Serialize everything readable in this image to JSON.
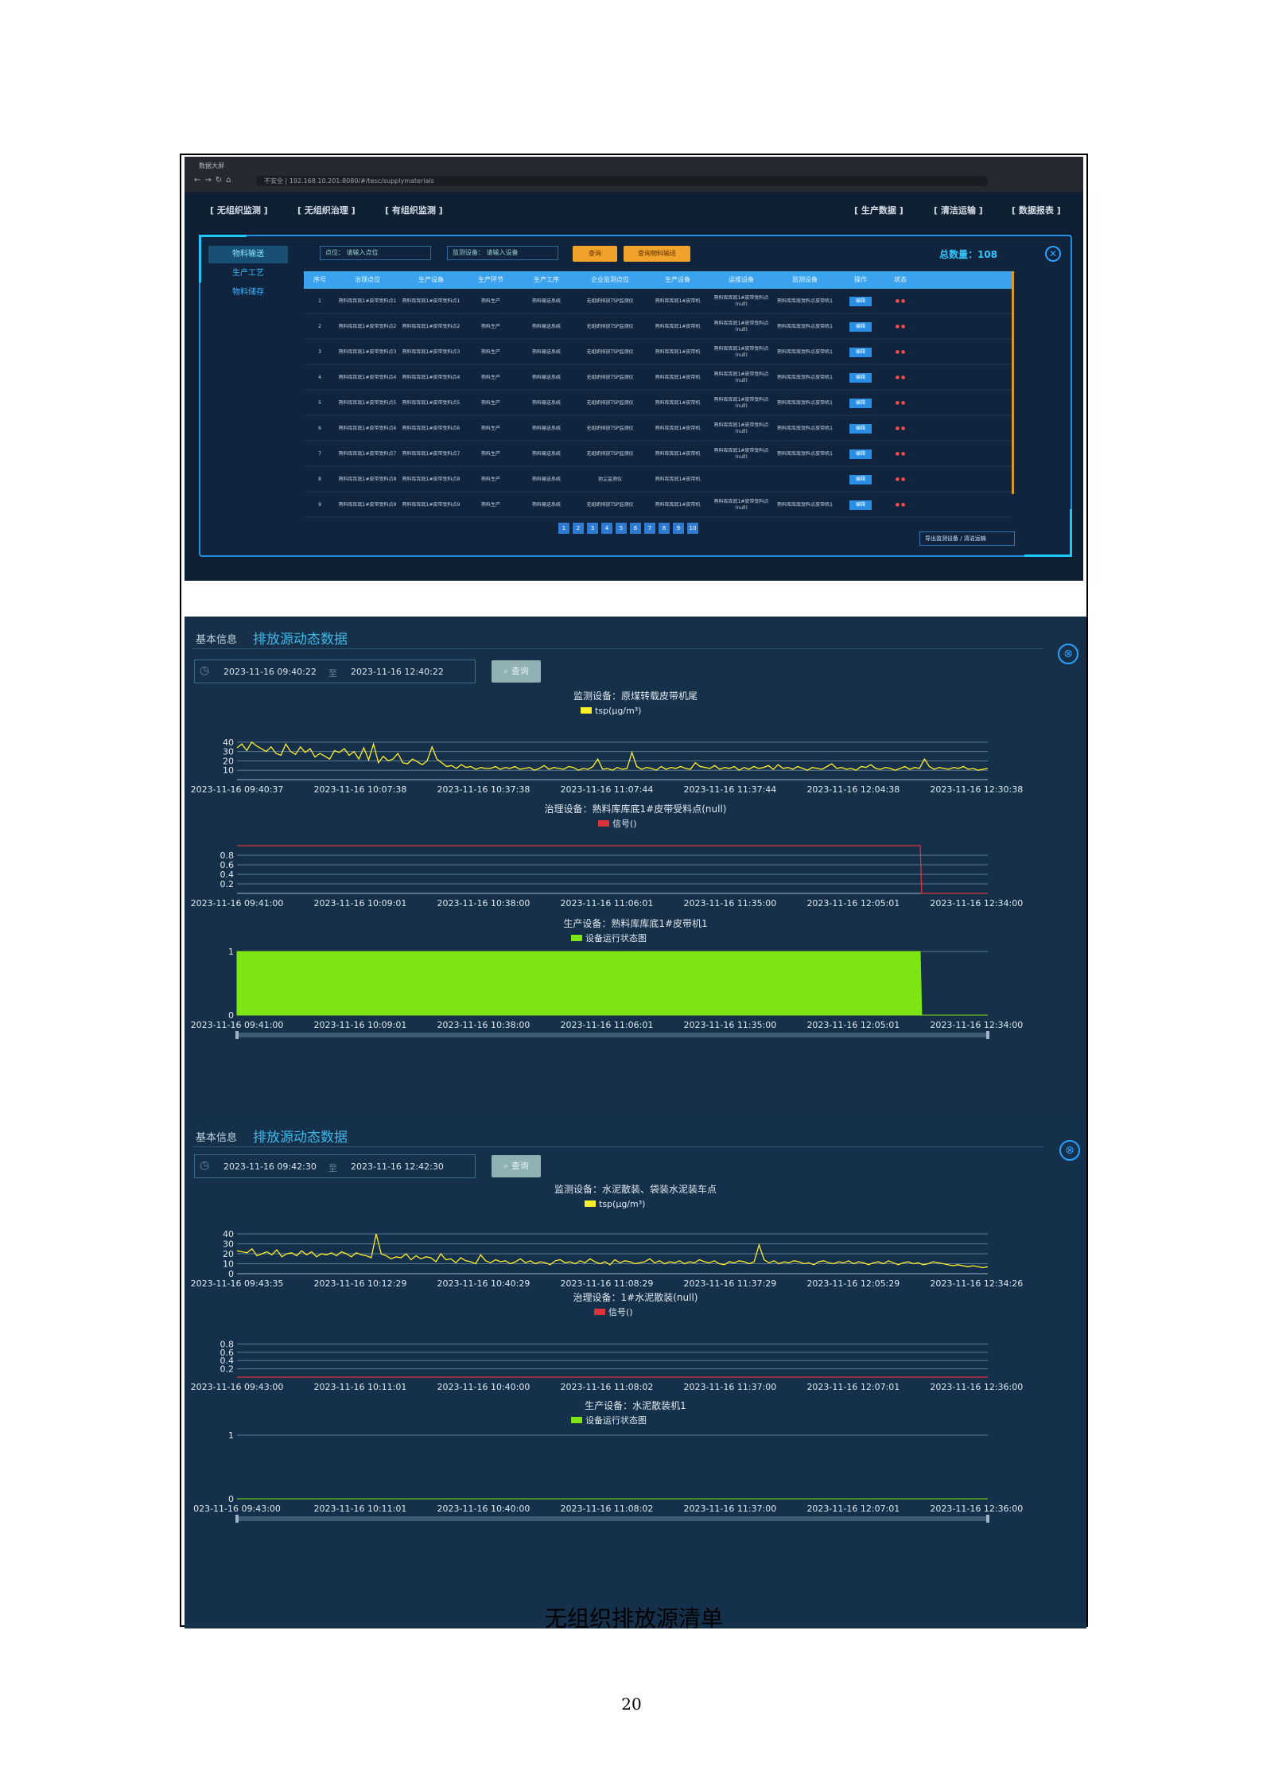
{
  "screenshot1": {
    "browser_tab": "数据大屏",
    "url": "不安全 | 192.168.10.201:8080/#/tesc/supplymaterials",
    "top_menu_left": [
      "[ 无组织监测 ]",
      "[ 无组织治理 ]",
      "[ 有组织监测 ]"
    ],
    "top_menu_right": [
      "[ 生产数据 ]",
      "[ 清洁运输 ]",
      "[ 数据报表 ]"
    ],
    "sidebar": [
      "物料输送",
      "生产工艺",
      "物料储存"
    ],
    "filter_1_label": "点位：",
    "filter_1_placeholder": "请输入点位",
    "filter_2_label": "监测设备：",
    "filter_2_placeholder": "请输入设备",
    "search_btn": "查询",
    "reset_btn": "查询物料输送",
    "total": "总数量：108",
    "columns": [
      "序号",
      "治理点位",
      "生产设备",
      "生产环节",
      "生产工序",
      "企业监测点位",
      "生产设备",
      "运维设备",
      "监测设备",
      "操作",
      "状态"
    ],
    "rows": [
      {
        "no": "1",
        "c1": "熟料库库底1#皮带受料点1",
        "c2": "熟料库库底1#皮带受料点1",
        "c3": "熟料生产",
        "c4": "熟料输送系统",
        "c5": "无组织排放TSP监测仪",
        "c6": "熟料库库底1#皮带机",
        "c7": "熟料库库底1#皮带受料点(null)",
        "c8": "熟料库库底受料点皮带机1",
        "op": "编辑"
      },
      {
        "no": "2",
        "c1": "熟料库库底1#皮带受料点2",
        "c2": "熟料库库底1#皮带受料点2",
        "c3": "熟料生产",
        "c4": "熟料输送系统",
        "c5": "无组织排放TSP监测仪",
        "c6": "熟料库库底1#皮带机",
        "c7": "熟料库库底1#皮带受料点(null)",
        "c8": "熟料库库底受料点皮带机1",
        "op": "编辑"
      },
      {
        "no": "3",
        "c1": "熟料库库底1#皮带受料点3",
        "c2": "熟料库库底1#皮带受料点3",
        "c3": "熟料生产",
        "c4": "熟料输送系统",
        "c5": "无组织排放TSP监测仪",
        "c6": "熟料库库底1#皮带机",
        "c7": "熟料库库底1#皮带受料点(null)",
        "c8": "熟料库库底受料点皮带机1",
        "op": "编辑"
      },
      {
        "no": "4",
        "c1": "熟料库库底1#皮带受料点4",
        "c2": "熟料库库底1#皮带受料点4",
        "c3": "熟料生产",
        "c4": "熟料输送系统",
        "c5": "无组织排放TSP监测仪",
        "c6": "熟料库库底1#皮带机",
        "c7": "熟料库库底1#皮带受料点(null)",
        "c8": "熟料库库底受料点皮带机1",
        "op": "编辑"
      },
      {
        "no": "5",
        "c1": "熟料库库底1#皮带受料点5",
        "c2": "熟料库库底1#皮带受料点5",
        "c3": "熟料生产",
        "c4": "熟料输送系统",
        "c5": "无组织排放TSP监测仪",
        "c6": "熟料库库底1#皮带机",
        "c7": "熟料库库底1#皮带受料点(null)",
        "c8": "熟料库库底受料点皮带机1",
        "op": "编辑"
      },
      {
        "no": "6",
        "c1": "熟料库库底1#皮带受料点6",
        "c2": "熟料库库底1#皮带受料点6",
        "c3": "熟料生产",
        "c4": "熟料输送系统",
        "c5": "无组织排放TSP监测仪",
        "c6": "熟料库库底1#皮带机",
        "c7": "熟料库库底1#皮带受料点(null)",
        "c8": "熟料库库底受料点皮带机1",
        "op": "编辑"
      },
      {
        "no": "7",
        "c1": "熟料库库底1#皮带受料点7",
        "c2": "熟料库库底1#皮带受料点7",
        "c3": "熟料生产",
        "c4": "熟料输送系统",
        "c5": "无组织排放TSP监测仪",
        "c6": "熟料库库底1#皮带机",
        "c7": "熟料库库底1#皮带受料点(null)",
        "c8": "熟料库库底受料点皮带机1",
        "op": "编辑"
      },
      {
        "no": "8",
        "c1": "熟料库库底1#皮带受料点8",
        "c2": "熟料库库底1#皮带受料点8",
        "c3": "熟料生产",
        "c4": "熟料输送系统",
        "c5": "扬尘监测仪",
        "c6": "熟料库库底1#皮带机",
        "c7": "",
        "c8": "",
        "op": "编辑"
      },
      {
        "no": "9",
        "c1": "熟料库库底1#皮带受料点9",
        "c2": "熟料库库底1#皮带受料点9",
        "c3": "熟料生产",
        "c4": "熟料输送系统",
        "c5": "无组织排放TSP监测仪",
        "c6": "熟料库库底1#皮带机",
        "c7": "熟料库库底1#皮带受料点(null)",
        "c8": "熟料库库底受料点皮带机1",
        "op": "编辑"
      }
    ],
    "pages": [
      "1",
      "2",
      "3",
      "4",
      "5",
      "6",
      "7",
      "8",
      "9",
      "10"
    ],
    "export_btn": "导出监测设备 / 清洁运输"
  },
  "panel1": {
    "basic": "基本信息",
    "title": "排放源动态数据",
    "start": "2023-11-16 09:40:22",
    "to": "至",
    "end": "2023-11-16 12:40:22",
    "query": "查询",
    "close": "⊗"
  },
  "panel2": {
    "basic": "基本信息",
    "title": "排放源动态数据",
    "start": "2023-11-16 09:42:30",
    "to": "至",
    "end": "2023-11-16 12:42:30",
    "query": "查询",
    "close": "⊗"
  },
  "caption": "无组织排放源清单",
  "page_number": "20",
  "chart_data": [
    {
      "type": "line",
      "title": "监测设备：原煤转载皮带机尾",
      "series": [
        {
          "name": "tsp(μg/m³)",
          "color": "#ffef2a",
          "values": [
            34,
            38,
            31,
            40,
            36,
            33,
            30,
            35,
            28,
            26,
            38,
            30,
            27,
            35,
            29,
            33,
            24,
            28,
            25,
            22,
            31,
            29,
            33,
            26,
            30,
            22,
            34,
            21,
            38,
            18,
            25,
            20,
            22,
            28,
            18,
            17,
            22,
            19,
            16,
            20,
            35,
            22,
            18,
            14,
            15,
            12,
            16,
            13,
            14,
            11,
            13,
            12,
            12,
            14,
            11,
            13,
            12,
            14,
            11,
            12,
            13,
            10,
            12,
            15,
            11,
            13,
            12,
            11,
            14,
            13,
            10,
            12,
            11,
            14,
            22,
            11,
            12,
            10,
            13,
            11,
            12,
            29,
            14,
            11,
            13,
            12,
            10,
            14,
            11,
            13,
            12,
            14,
            12,
            11,
            18,
            14,
            13,
            12,
            15,
            11,
            13,
            12,
            14,
            10,
            13,
            11,
            14,
            12,
            13,
            15,
            11,
            16,
            12,
            13,
            11,
            14,
            12,
            10,
            13,
            12,
            11,
            14,
            17,
            12,
            13,
            11,
            12,
            10,
            14,
            13,
            16,
            12,
            11,
            13,
            12,
            10,
            12,
            14,
            11,
            13,
            12,
            22,
            14,
            11,
            13,
            12,
            11,
            13,
            12,
            14,
            11,
            12,
            10,
            11,
            12
          ]
        }
      ],
      "x_ticks": [
        "2023-11-16 09:40:37",
        "2023-11-16 10:07:38",
        "2023-11-16 10:37:38",
        "2023-11-16 11:07:44",
        "2023-11-16 11:37:44",
        "2023-11-16 12:04:38",
        "2023-11-16 12:30:38"
      ],
      "y_ticks": [
        "40",
        "30",
        "20",
        "10"
      ],
      "ylim": [
        0,
        45
      ]
    },
    {
      "type": "line",
      "title": "治理设备：熟料库库底1#皮带受料点(null)",
      "series": [
        {
          "name": "信号()",
          "color": "#d9343a",
          "values": [
            {
              "x": 0.0,
              "y": 1
            },
            {
              "x": 0.91,
              "y": 1
            },
            {
              "x": 0.912,
              "y": 0
            },
            {
              "x": 1.0,
              "y": 0
            }
          ]
        }
      ],
      "x_ticks": [
        "2023-11-16 09:41:00",
        "2023-11-16 10:09:01",
        "2023-11-16 10:38:00",
        "2023-11-16 11:06:01",
        "2023-11-16 11:35:00",
        "2023-11-16 12:05:01",
        "2023-11-16 12:34:00"
      ],
      "y_ticks": [
        "0.8",
        "0.6",
        "0.4",
        "0.2"
      ],
      "ylim": [
        0,
        1
      ]
    },
    {
      "type": "area",
      "title": "生产设备：熟料库库底1#皮带机1",
      "series": [
        {
          "name": "设备运行状态图",
          "color": "#7ee514",
          "values": [
            {
              "x": 0.0,
              "y": 1
            },
            {
              "x": 0.91,
              "y": 1
            },
            {
              "x": 0.912,
              "y": 0
            },
            {
              "x": 1.0,
              "y": 0
            }
          ]
        }
      ],
      "x_ticks": [
        "2023-11-16 09:41:00",
        "2023-11-16 10:09:01",
        "2023-11-16 10:38:00",
        "2023-11-16 11:06:01",
        "2023-11-16 11:35:00",
        "2023-11-16 12:05:01",
        "2023-11-16 12:34:00"
      ],
      "y_ticks": [
        "1",
        "0"
      ],
      "ylim": [
        0,
        1
      ]
    },
    {
      "type": "line",
      "title": "监测设备：水泥散装、袋装水泥装车点",
      "series": [
        {
          "name": "tsp(μg/m³)",
          "color": "#ffef2a",
          "values": [
            23,
            22,
            21,
            25,
            18,
            20,
            22,
            19,
            24,
            17,
            20,
            21,
            18,
            23,
            19,
            22,
            17,
            20,
            19,
            21,
            18,
            22,
            20,
            17,
            21,
            19,
            18,
            16,
            40,
            20,
            18,
            15,
            17,
            16,
            20,
            14,
            18,
            15,
            17,
            16,
            12,
            20,
            14,
            15,
            11,
            16,
            13,
            12,
            10,
            19,
            13,
            11,
            14,
            12,
            13,
            10,
            12,
            15,
            11,
            13,
            10,
            12,
            11,
            9,
            13,
            14,
            11,
            12,
            10,
            13,
            11,
            15,
            12,
            10,
            12,
            9,
            14,
            11,
            13,
            12,
            10,
            11,
            12,
            15,
            11,
            13,
            10,
            12,
            11,
            13,
            10,
            12,
            11,
            14,
            12,
            11,
            13,
            10,
            9,
            12,
            11,
            13,
            12,
            10,
            12,
            29,
            14,
            11,
            13,
            10,
            12,
            11,
            13,
            12,
            10,
            11,
            9,
            12,
            13,
            11,
            10,
            12,
            11,
            13,
            10,
            12,
            11,
            9,
            11,
            12,
            10,
            13,
            11,
            9,
            11,
            12,
            10,
            11,
            9,
            10,
            12,
            11,
            10,
            9,
            8,
            9,
            8,
            7,
            8,
            7,
            6,
            7
          ]
        }
      ],
      "x_ticks": [
        "2023-11-16 09:43:35",
        "2023-11-16 10:12:29",
        "2023-11-16 10:40:29",
        "2023-11-16 11:08:29",
        "2023-11-16 11:37:29",
        "2023-11-16 12:05:29",
        "2023-11-16 12:34:26"
      ],
      "y_ticks": [
        "40",
        "30",
        "20",
        "10",
        "0"
      ],
      "ylim": [
        0,
        40
      ]
    },
    {
      "type": "line",
      "title": "治理设备：1#水泥散装(null)",
      "series": [
        {
          "name": "信号()",
          "color": "#d9343a",
          "values": [
            {
              "x": 0.0,
              "y": 0
            },
            {
              "x": 1.0,
              "y": 0
            }
          ]
        }
      ],
      "x_ticks": [
        "2023-11-16 09:43:00",
        "2023-11-16 10:11:01",
        "2023-11-16 10:40:00",
        "2023-11-16 11:08:02",
        "2023-11-16 11:37:00",
        "2023-11-16 12:07:01",
        "2023-11-16 12:36:00"
      ],
      "y_ticks": [
        "0.8",
        "0.6",
        "0.4",
        "0.2"
      ],
      "ylim": [
        0,
        1
      ]
    },
    {
      "type": "area",
      "title": "生产设备：水泥散装机1",
      "series": [
        {
          "name": "设备运行状态图",
          "color": "#7ee514",
          "values": [
            {
              "x": 0.0,
              "y": 0
            },
            {
              "x": 1.0,
              "y": 0
            }
          ]
        }
      ],
      "x_ticks": [
        "023-11-16 09:43:00",
        "2023-11-16 10:11:01",
        "2023-11-16 10:40:00",
        "2023-11-16 11:08:02",
        "2023-11-16 11:37:00",
        "2023-11-16 12:07:01",
        "2023-11-16 12:36:00"
      ],
      "y_ticks": [
        "1",
        "0"
      ],
      "ylim": [
        0,
        1
      ]
    }
  ]
}
